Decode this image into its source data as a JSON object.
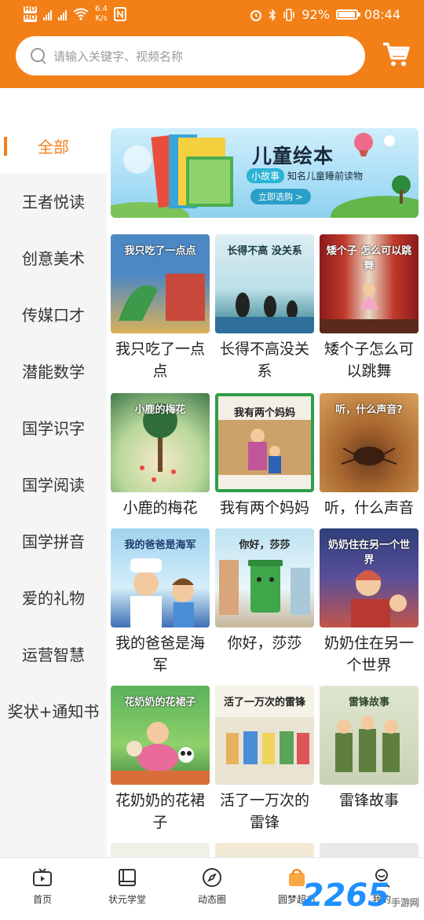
{
  "status_bar": {
    "net_speed": "6.4",
    "net_speed_unit": "K/s",
    "battery": "92%",
    "time": "08:44"
  },
  "search": {
    "placeholder": "请输入关键字、视频名称"
  },
  "sidebar": {
    "items": [
      {
        "label": "全部",
        "active": true
      },
      {
        "label": "王者悦读"
      },
      {
        "label": "创意美术"
      },
      {
        "label": "传媒口才"
      },
      {
        "label": "潜能数学"
      },
      {
        "label": "国学识字"
      },
      {
        "label": "国学阅读"
      },
      {
        "label": "国学拼音"
      },
      {
        "label": "爱的礼物"
      },
      {
        "label": "运营智慧"
      },
      {
        "label": "奖状+通知书"
      }
    ]
  },
  "banner": {
    "title": "儿童绘本",
    "tag": "小故事",
    "subtitle": "知名儿童睡前读物",
    "button": "立即选购 >"
  },
  "products": [
    {
      "title": "我只吃了一点点",
      "cover_text": "我只吃了一点点"
    },
    {
      "title": "长得不高没关系",
      "cover_text": "长得不高 没关系"
    },
    {
      "title": "矮个子怎么可以跳舞",
      "cover_text": "矮个子 怎么可以跳舞"
    },
    {
      "title": "小鹿的梅花",
      "cover_text": "小鹿的梅花"
    },
    {
      "title": "我有两个妈妈",
      "cover_text": "我有两个妈妈"
    },
    {
      "title": "听，什么声音",
      "cover_text": "听，什么声音?"
    },
    {
      "title": "我的爸爸是海军",
      "cover_text": "我的爸爸是海军"
    },
    {
      "title": "你好，莎莎",
      "cover_text": "你好，莎莎"
    },
    {
      "title": "奶奶住在另一个世界",
      "cover_text": "奶奶住在另一个世界"
    },
    {
      "title": "花奶奶的花裙子",
      "cover_text": "花奶奶的花裙子"
    },
    {
      "title": "活了一万次的雷锋",
      "cover_text": "活了一万次的雷锋"
    },
    {
      "title": "雷锋故事",
      "cover_text": "雷锋故事"
    }
  ],
  "tabbar": {
    "items": [
      {
        "label": "首页",
        "icon": "tv-icon"
      },
      {
        "label": "状元学堂",
        "icon": "book-icon"
      },
      {
        "label": "动态圈",
        "icon": "compass-icon"
      },
      {
        "label": "圆梦超市",
        "icon": "shopping-bag-icon",
        "active": true
      },
      {
        "label": "我的",
        "icon": "user-icon"
      }
    ]
  },
  "watermark": {
    "brand": "2265",
    "suffix": "手游网"
  },
  "colors": {
    "accent": "#f37f17",
    "sidebar_bg": "#f5f5f5"
  }
}
